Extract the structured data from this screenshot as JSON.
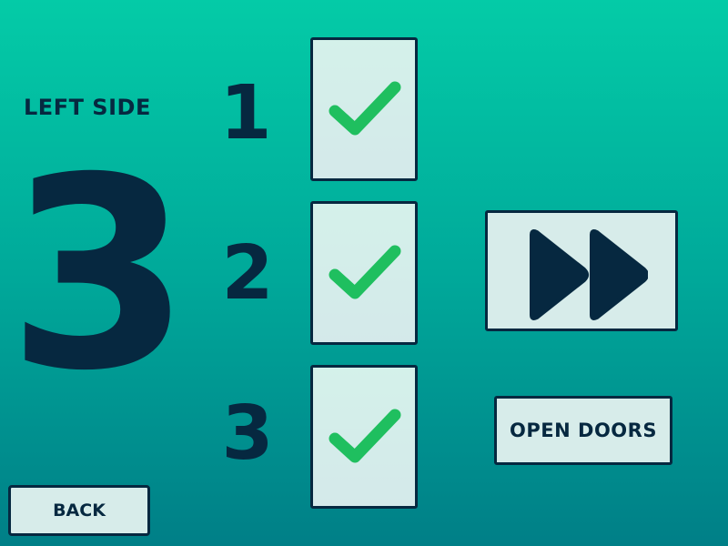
{
  "side": {
    "label": "LEFT SIDE",
    "selected_number": "3"
  },
  "rows": [
    {
      "number": "1",
      "checked": true,
      "icon": "checkmark-icon"
    },
    {
      "number": "2",
      "checked": true,
      "icon": "checkmark-icon"
    },
    {
      "number": "3",
      "checked": true,
      "icon": "checkmark-icon"
    }
  ],
  "controls": {
    "fast_forward_icon": "fast-forward-icon",
    "open_doors_label": "OPEN DOORS",
    "back_label": "BACK"
  },
  "colors": {
    "background_top": "#04cba7",
    "background_bottom": "#007f87",
    "ink": "#062840",
    "check_green": "#1fbf5f",
    "panel": "#d7ecea"
  }
}
